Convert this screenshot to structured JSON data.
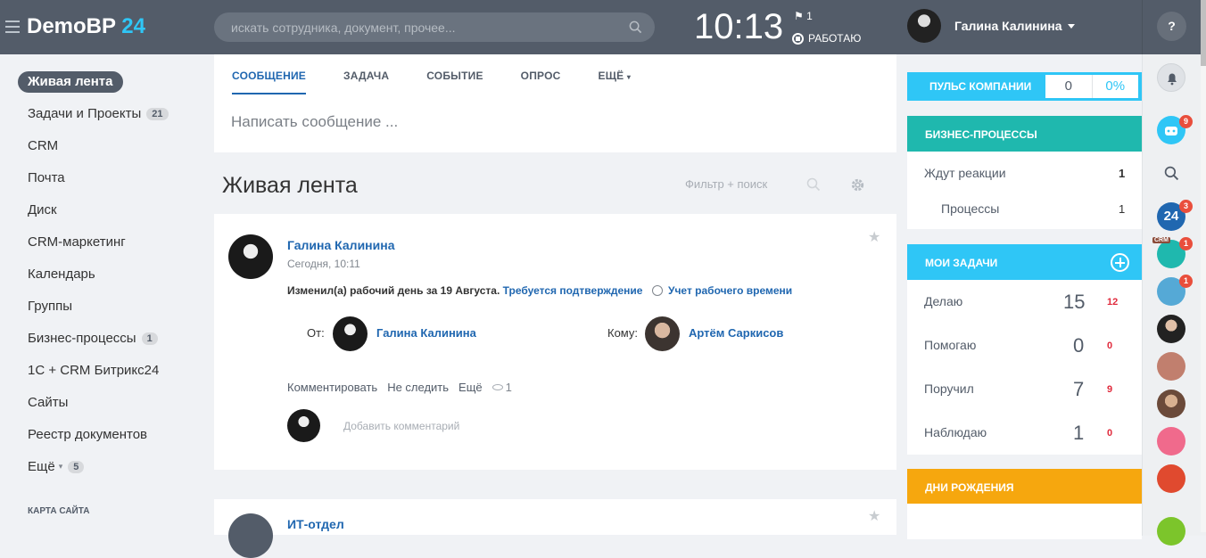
{
  "header": {
    "logo": "DemoBP",
    "logo_num": "24",
    "search_placeholder": "искать сотрудника, документ, прочее...",
    "time": "10:13",
    "flag_count": "1",
    "status": "РАБОТАЮ",
    "user_name": "Галина Калинина",
    "help": "?"
  },
  "sidebar": {
    "active": "Живая лента",
    "items": [
      {
        "label": "Задачи и Проекты",
        "counter": "21"
      },
      {
        "label": "CRM",
        "counter": ""
      },
      {
        "label": "Почта",
        "counter": ""
      },
      {
        "label": "Диск",
        "counter": ""
      },
      {
        "label": "CRM-маркетинг",
        "counter": ""
      },
      {
        "label": "Календарь",
        "counter": ""
      },
      {
        "label": "Группы",
        "counter": ""
      },
      {
        "label": "Бизнес-процессы",
        "counter": "1"
      },
      {
        "label": "1C + CRM Битрикс24",
        "counter": ""
      },
      {
        "label": "Сайты",
        "counter": ""
      },
      {
        "label": "Реестр документов",
        "counter": ""
      },
      {
        "label": "Ещё",
        "counter": "5"
      }
    ],
    "sitemap": "КАРТА САЙТА"
  },
  "composer": {
    "tabs": [
      "СООБЩЕНИЕ",
      "ЗАДАЧА",
      "СОБЫТИЕ",
      "ОПРОС",
      "ЕЩЁ"
    ],
    "placeholder": "Написать сообщение ..."
  },
  "feed": {
    "title": "Живая лента",
    "filter": "Фильтр + поиск",
    "post": {
      "author": "Галина Калинина",
      "time": "Сегодня, 10:11",
      "text": "Изменил(а) рабочий день за 19 Августа.",
      "link": "Требуется подтверждение",
      "worktime": "Учет рабочего времени",
      "from_label": "От:",
      "from_name": "Галина Калинина",
      "to_label": "Кому:",
      "to_name": "Артём Саркисов",
      "actions": [
        "Комментировать",
        "Не следить",
        "Ещё"
      ],
      "views": "1",
      "add_comment": "Добавить комментарий"
    },
    "post2_author": "ИТ-отдел"
  },
  "right": {
    "pulse_label": "ПУЛЬС КОМПАНИИ",
    "pulse_value": "0",
    "pulse_percent": "0%",
    "bp_title": "БИЗНЕС-ПРОЦЕССЫ",
    "bp_rows": [
      {
        "label": "Ждут реакции",
        "value": "1"
      },
      {
        "label": "Процессы",
        "value": "1"
      }
    ],
    "tasks_title": "МОИ ЗАДАЧИ",
    "tasks": [
      {
        "label": "Делаю",
        "count": "15",
        "overdue": "12"
      },
      {
        "label": "Помогаю",
        "count": "0",
        "overdue": "0"
      },
      {
        "label": "Поручил",
        "count": "7",
        "overdue": "9"
      },
      {
        "label": "Наблюдаю",
        "count": "1",
        "overdue": "0"
      }
    ],
    "birthdays_title": "ДНИ РОЖДЕНИЯ"
  },
  "iconbar": {
    "bot_badge": "9",
    "b24_label": "24",
    "b24_badge": "3",
    "crm_tag": "CRM",
    "crm_badge": "1",
    "user_badge": "1"
  }
}
